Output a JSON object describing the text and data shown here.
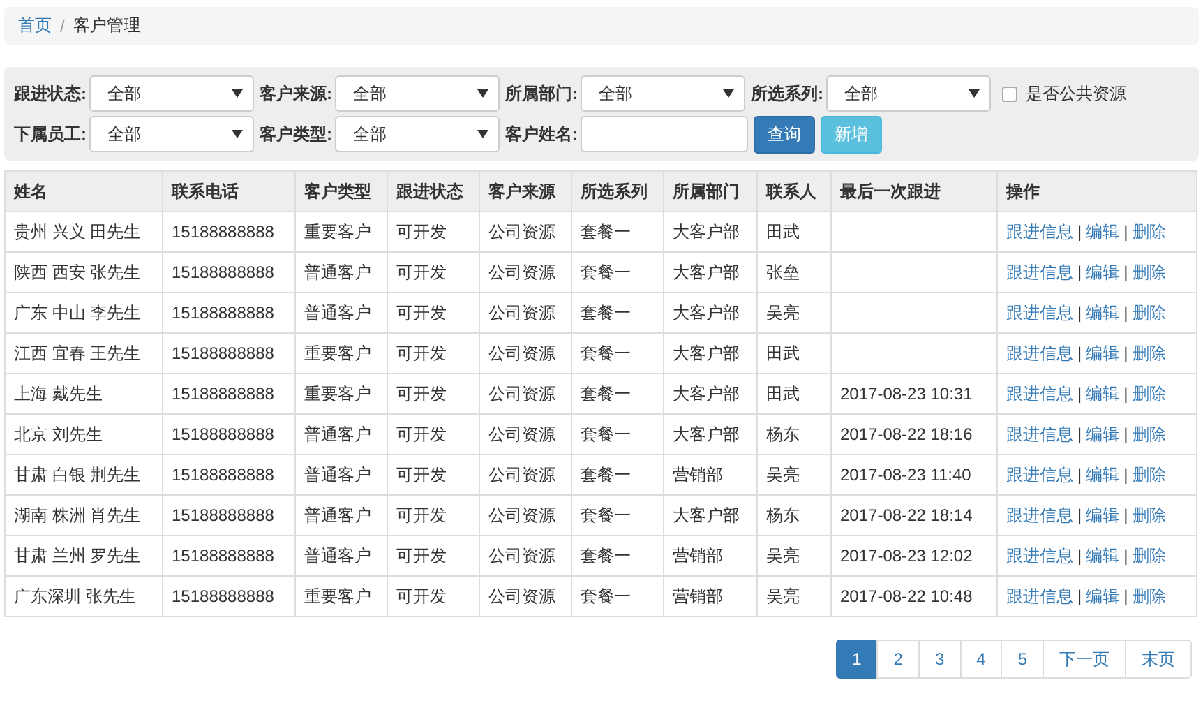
{
  "breadcrumb": [
    "首页",
    "客户管理"
  ],
  "breadcrumb_separator": "/",
  "filters": [
    [
      {
        "kind": "select",
        "label": "跟进状态:",
        "value": "全部"
      },
      {
        "kind": "select",
        "label": "客户来源:",
        "value": "全部"
      },
      {
        "kind": "select",
        "label": "所属部门:",
        "value": "全部"
      },
      {
        "kind": "select",
        "label": "所选系列:",
        "value": "全部"
      },
      {
        "kind": "checkbox",
        "label": "是否公共资源",
        "checked": false
      }
    ],
    [
      {
        "kind": "select",
        "label": "下属员工:",
        "value": "全部"
      },
      {
        "kind": "select",
        "label": "客户类型:",
        "value": "全部"
      },
      {
        "kind": "text",
        "label": "客户姓名:"
      },
      {
        "kind": "primary_button",
        "label": "查询"
      },
      {
        "kind": "info_button",
        "label": "新增"
      }
    ]
  ],
  "table": {
    "columns": [
      "姓名",
      "联系电话",
      "客户类型",
      "跟进状态",
      "客户来源",
      "所选系列",
      "所属部门",
      "联系人",
      "最后一次跟进",
      "操作"
    ],
    "action_separator": "|",
    "rows": [
      {
        "cells": [
          "贵州 兴义 田先生",
          "15188888888",
          "重要客户",
          "可开发",
          "公司资源",
          "套餐一",
          "大客户部",
          "田武",
          ""
        ],
        "actions": [
          "跟进信息",
          "编辑",
          "删除"
        ]
      },
      {
        "cells": [
          "陕西 西安 张先生",
          "15188888888",
          "普通客户",
          "可开发",
          "公司资源",
          "套餐一",
          "大客户部",
          "张垒",
          ""
        ],
        "actions": [
          "跟进信息",
          "编辑",
          "删除"
        ]
      },
      {
        "cells": [
          "广东 中山 李先生",
          "15188888888",
          "普通客户",
          "可开发",
          "公司资源",
          "套餐一",
          "大客户部",
          "吴亮",
          ""
        ],
        "actions": [
          "跟进信息",
          "编辑",
          "删除"
        ]
      },
      {
        "cells": [
          "江西 宜春 王先生",
          "15188888888",
          "重要客户",
          "可开发",
          "公司资源",
          "套餐一",
          "大客户部",
          "田武",
          ""
        ],
        "actions": [
          "跟进信息",
          "编辑",
          "删除"
        ]
      },
      {
        "cells": [
          "上海 戴先生",
          "15188888888",
          "重要客户",
          "可开发",
          "公司资源",
          "套餐一",
          "大客户部",
          "田武",
          "2017-08-23 10:31"
        ],
        "actions": [
          "跟进信息",
          "编辑",
          "删除"
        ]
      },
      {
        "cells": [
          "北京 刘先生",
          "15188888888",
          "普通客户",
          "可开发",
          "公司资源",
          "套餐一",
          "大客户部",
          "杨东",
          "2017-08-22 18:16"
        ],
        "actions": [
          "跟进信息",
          "编辑",
          "删除"
        ]
      },
      {
        "cells": [
          "甘肃 白银 荆先生",
          "15188888888",
          "普通客户",
          "可开发",
          "公司资源",
          "套餐一",
          "营销部",
          "吴亮",
          "2017-08-23 11:40"
        ],
        "actions": [
          "跟进信息",
          "编辑",
          "删除"
        ]
      },
      {
        "cells": [
          "湖南 株洲 肖先生",
          "15188888888",
          "普通客户",
          "可开发",
          "公司资源",
          "套餐一",
          "大客户部",
          "杨东",
          "2017-08-22 18:14"
        ],
        "actions": [
          "跟进信息",
          "编辑",
          "删除"
        ]
      },
      {
        "cells": [
          "甘肃 兰州 罗先生",
          "15188888888",
          "普通客户",
          "可开发",
          "公司资源",
          "套餐一",
          "营销部",
          "吴亮",
          "2017-08-23 12:02"
        ],
        "actions": [
          "跟进信息",
          "编辑",
          "删除"
        ]
      },
      {
        "cells": [
          "广东深圳 张先生",
          "15188888888",
          "重要客户",
          "可开发",
          "公司资源",
          "套餐一",
          "营销部",
          "吴亮",
          "2017-08-22 10:48"
        ],
        "actions": [
          "跟进信息",
          "编辑",
          "删除"
        ]
      }
    ]
  },
  "pagination": [
    {
      "label": "1",
      "selected": true
    },
    {
      "label": "2",
      "selected": false
    },
    {
      "label": "3",
      "selected": false
    },
    {
      "label": "4",
      "selected": false
    },
    {
      "label": "5",
      "selected": false
    },
    {
      "label": "下一页",
      "selected": false
    },
    {
      "label": "末页",
      "selected": false
    }
  ]
}
